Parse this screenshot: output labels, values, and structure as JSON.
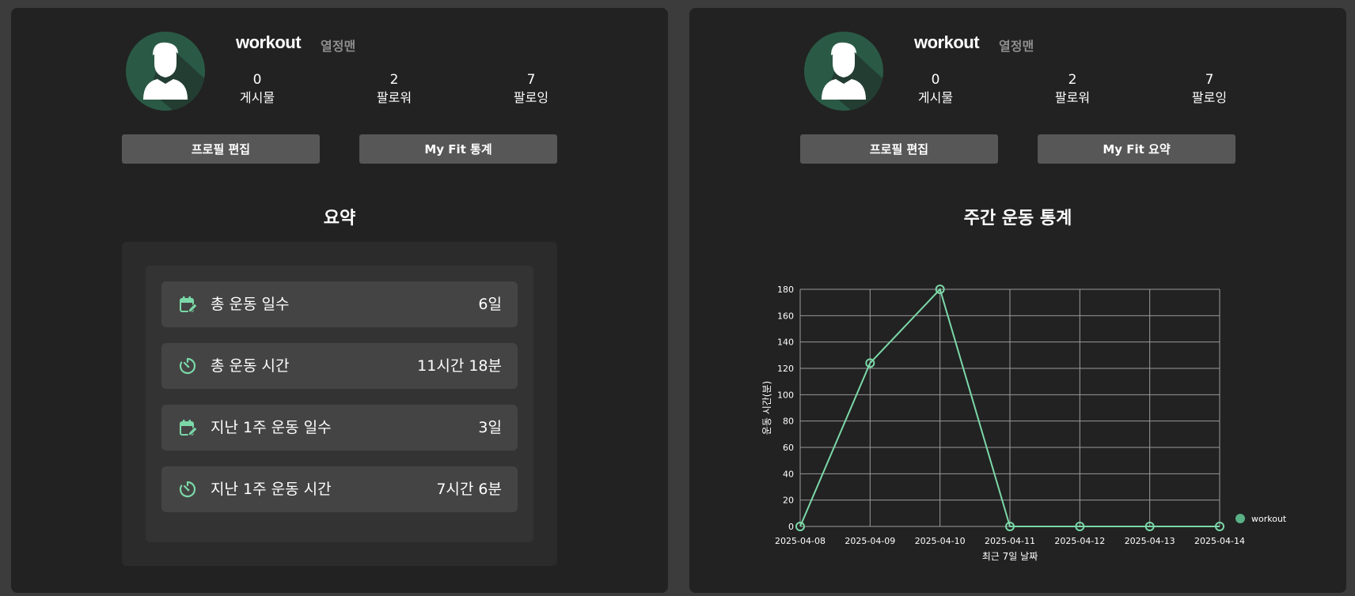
{
  "colors": {
    "page_bg": "#3c3c3c",
    "panel_bg": "#222222",
    "button_bg": "#575757",
    "accent_green": "#7bd8a8",
    "avatar_bg": "#2a5a46",
    "nickname_gray": "#8e8e8e"
  },
  "left_panel": {
    "profile": {
      "username": "workout",
      "nickname": "열정맨",
      "stats": [
        {
          "value": "0",
          "label": "게시물"
        },
        {
          "value": "2",
          "label": "팔로워"
        },
        {
          "value": "7",
          "label": "팔로잉"
        }
      ],
      "edit_button": "프로필 편집",
      "secondary_button": "My Fit 통계"
    },
    "section_title": "요약",
    "summary": [
      {
        "icon": "calendar-edit-icon",
        "label": "총 운동 일수",
        "value": "6일"
      },
      {
        "icon": "timer-icon",
        "label": "총 운동 시간",
        "value": "11시간 18분"
      },
      {
        "icon": "calendar-edit-icon",
        "label": "지난 1주 운동 일수",
        "value": "3일"
      },
      {
        "icon": "timer-icon",
        "label": "지난 1주 운동 시간",
        "value": "7시간 6분"
      }
    ]
  },
  "right_panel": {
    "profile": {
      "username": "workout",
      "nickname": "열정맨",
      "stats": [
        {
          "value": "0",
          "label": "게시물"
        },
        {
          "value": "2",
          "label": "팔로워"
        },
        {
          "value": "7",
          "label": "팔로잉"
        }
      ],
      "edit_button": "프로필 편집",
      "secondary_button": "My Fit 요약"
    },
    "section_title": "주간 운동 통계"
  },
  "chart_data": {
    "type": "line",
    "x": [
      "2025-04-08",
      "2025-04-09",
      "2025-04-10",
      "2025-04-11",
      "2025-04-12",
      "2025-04-13",
      "2025-04-14"
    ],
    "series": [
      {
        "name": "workout",
        "values": [
          0,
          124,
          180,
          0,
          0,
          0,
          0
        ],
        "color": "#7bd8a8"
      }
    ],
    "xlabel": "최근 7일 날짜",
    "ylabel": "운동 시간(분)",
    "ylim": [
      0,
      180
    ],
    "yticks": [
      "0",
      "20",
      "40",
      "60",
      "80",
      "100",
      "120",
      "140",
      "160",
      "180"
    ],
    "grid": true,
    "legend_position": "bottom-right"
  }
}
